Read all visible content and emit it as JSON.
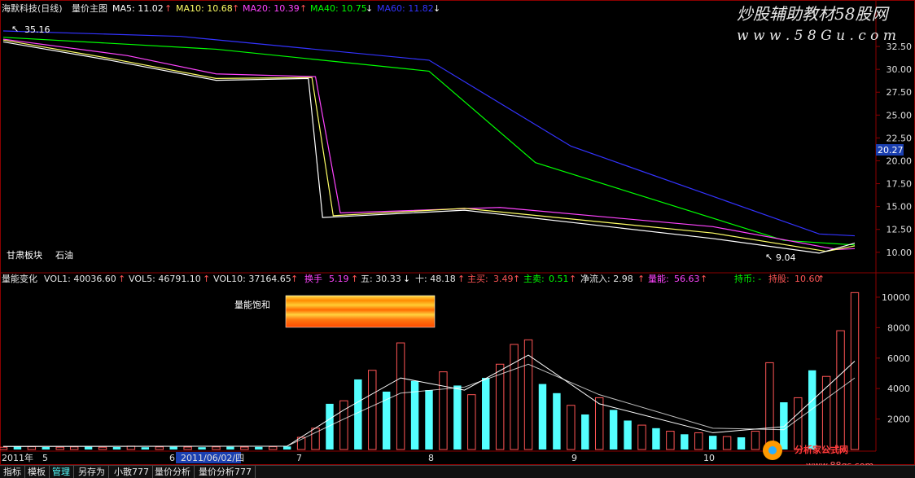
{
  "title_bar": {
    "stock": "海默科技(日线)",
    "indicator": "量价主图",
    "ma5": "MA5: 11.02",
    "ma10": "MA10: 10.68",
    "ma20": "MA20: 10.39",
    "ma40": "MA40: 10.75",
    "ma60": "MA60: 11.82"
  },
  "watermark_top": {
    "line1": "炒股辅助教材58股网",
    "line2": "w w w . 5 8 G u . c o m"
  },
  "watermark_bottom": {
    "line1": "分析家公式网",
    "line2": "www.88gs.com"
  },
  "annotations": {
    "high": "35.16",
    "low": "9.04",
    "sector": "甘肃板块",
    "industry": "石油"
  },
  "current_price": "20.27",
  "volume_bar": {
    "name": "量能变化",
    "vol1": "VOL1: 40036.60",
    "vol5": "VOL5: 46791.10",
    "vol10": "VOL10: 37164.65",
    "turnover_label": "换手",
    "turnover_value": "5.19",
    "wu": "五: 30.33",
    "shi": "十: 48.18",
    "zhumai_label": "主买:",
    "zhumai_value": "3.49",
    "zhumai2_label": "主卖:",
    "zhumai2_value": "0.51",
    "net_inflow": "净流入: 2.98",
    "energy_label": "量能:",
    "energy_value": "56.63",
    "chibi": "持币: -",
    "chigu_label": "持股:",
    "chigu_value": "10.60"
  },
  "saturation_label": "量能饱和",
  "x_axis": {
    "labels": [
      "2011年",
      "5",
      "6",
      "2011/06/02/四",
      "7",
      "8",
      "9",
      "10"
    ]
  },
  "tabs": [
    "指标",
    "模板",
    "管理",
    "另存为",
    "小散777",
    "量价分析",
    "量价分析777"
  ],
  "colors": {
    "up": "#ff5555",
    "down": "#54ffff",
    "ma5": "#ffffff",
    "ma10": "#ffff66",
    "ma20": "#ff44ff",
    "ma40": "#00ff00",
    "ma60": "#3333ff"
  },
  "chart_data": [
    {
      "type": "candlestick",
      "title": "海默科技(日线)",
      "y_ticks": [
        10.0,
        12.5,
        15.0,
        17.5,
        20.0,
        22.5,
        25.0,
        27.5,
        30.0,
        32.5
      ],
      "ylim": [
        8.2,
        35.8
      ],
      "x_range": [
        0,
        240
      ],
      "segments": [
        {
          "name": "ma60",
          "x": [
            0,
            50,
            120,
            160,
            230,
            240
          ],
          "y": [
            34.2,
            33.6,
            31.0,
            21.6,
            12.0,
            11.8
          ]
        },
        {
          "name": "ma40",
          "x": [
            0,
            60,
            120,
            150,
            220,
            240
          ],
          "y": [
            33.5,
            32.2,
            29.8,
            19.8,
            11.3,
            10.8
          ]
        },
        {
          "name": "ma20",
          "x": [
            0,
            35,
            60,
            88,
            95,
            140,
            200,
            235,
            240
          ],
          "y": [
            33.3,
            31.5,
            29.5,
            29.2,
            14.3,
            14.9,
            12.8,
            10.3,
            10.4
          ]
        },
        {
          "name": "ma10",
          "x": [
            0,
            30,
            60,
            87,
            93,
            130,
            200,
            232,
            240
          ],
          "y": [
            33.2,
            31.2,
            29.0,
            29.1,
            14.0,
            14.8,
            12.1,
            10.1,
            10.7
          ]
        },
        {
          "name": "ma5",
          "x": [
            0,
            30,
            60,
            86,
            90,
            130,
            200,
            230,
            240
          ],
          "y": [
            33.0,
            31.0,
            28.8,
            29.0,
            13.8,
            14.6,
            11.5,
            9.9,
            11.0
          ]
        }
      ]
    },
    {
      "type": "bar",
      "title": "量能变化",
      "y_ticks": [
        2000,
        4000,
        6000,
        8000,
        10000
      ],
      "ylim": [
        0,
        10800
      ],
      "x_range": [
        0,
        240
      ],
      "bar_x": [
        0,
        4,
        8,
        12,
        16,
        20,
        24,
        28,
        32,
        36,
        40,
        44,
        48,
        52,
        56,
        60,
        64,
        68,
        72,
        76,
        80,
        84,
        88,
        92,
        96,
        100,
        104,
        108,
        112,
        116,
        120,
        124,
        128,
        132,
        136,
        140,
        144,
        148,
        152,
        156,
        160,
        164,
        168,
        172,
        176,
        180,
        184,
        188,
        192,
        196,
        200,
        204,
        208,
        212,
        216,
        220,
        224,
        228,
        232,
        236,
        240
      ],
      "bar_values": [
        150,
        200,
        180,
        160,
        150,
        170,
        180,
        150,
        160,
        220,
        150,
        170,
        180,
        160,
        150,
        170,
        180,
        160,
        170,
        180,
        200,
        800,
        1400,
        3000,
        3200,
        4600,
        5200,
        3800,
        7000,
        4500,
        3900,
        5100,
        4200,
        3600,
        4700,
        5600,
        6900,
        7200,
        4300,
        3700,
        2900,
        2300,
        3400,
        2600,
        1900,
        1600,
        1400,
        1200,
        1000,
        1100,
        900,
        850,
        800,
        1200,
        5700,
        3100,
        3400,
        5200,
        4800,
        7800,
        10300
      ],
      "bar_up": [
        true,
        false,
        true,
        false,
        true,
        true,
        false,
        true,
        false,
        true,
        false,
        true,
        false,
        true,
        false,
        true,
        false,
        true,
        false,
        true,
        false,
        true,
        true,
        false,
        true,
        false,
        true,
        false,
        true,
        false,
        false,
        true,
        false,
        true,
        false,
        true,
        true,
        true,
        false,
        false,
        true,
        false,
        true,
        false,
        false,
        true,
        false,
        true,
        false,
        true,
        false,
        true,
        false,
        true,
        true,
        false,
        true,
        false,
        true,
        true,
        true
      ],
      "vol5": {
        "x": [
          0,
          80,
          96,
          112,
          130,
          148,
          168,
          200,
          220,
          240
        ],
        "y": [
          200,
          220,
          2600,
          4700,
          3900,
          6200,
          3000,
          1100,
          1500,
          5800
        ]
      },
      "vol10": {
        "x": [
          0,
          80,
          96,
          112,
          130,
          148,
          168,
          200,
          220,
          240
        ],
        "y": [
          200,
          220,
          2000,
          3700,
          4100,
          5600,
          3600,
          1400,
          1300,
          4700
        ]
      }
    }
  ]
}
